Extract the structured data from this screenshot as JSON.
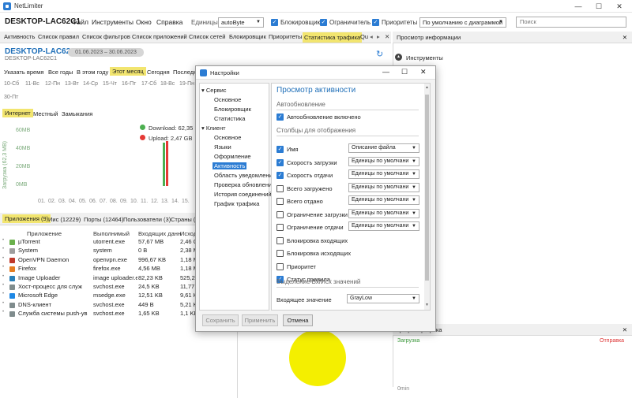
{
  "window": {
    "title": "NetLimiter"
  },
  "menubar": {
    "hostname": "DESKTOP-LAC62C1",
    "items": [
      "Файл",
      "Инструменты",
      "Окно",
      "Справка"
    ],
    "units_label": "Единицы",
    "units_value": "autoByte",
    "checkboxes": [
      "Блокировщик",
      "Ограничитель",
      "Приоритеты"
    ],
    "view_select": "По умолчанию с диаграммой",
    "search_placeholder": "Поиск"
  },
  "tabs": [
    "Активность",
    "Список правил",
    "Список фильтров",
    "Список приложений",
    "Список сетей",
    "Блокировщик",
    "Приоритеты",
    "Статистика трафика",
    "Qu"
  ],
  "stats": {
    "host": "DESKTOP-LAC62C1",
    "host_small": "DESKTOP-LAC62C1",
    "date_range": "01.06.2023 – 30.06.2023",
    "periods": [
      "Указать время",
      "Все годы",
      "В этом году",
      "Этот месяц",
      "Сегодня",
      "Последн"
    ],
    "days": [
      "10-Сб",
      "11-Вс",
      "12-Пн",
      "13-Вт",
      "14-Ср",
      "15-Чт",
      "16-Пт",
      "17-Сб",
      "18-Вс",
      "19-Пн",
      "30-Пт"
    ],
    "scope_tabs": [
      "Интернет",
      "Местный",
      "Замыкания"
    ]
  },
  "chart_data": {
    "type": "bar",
    "ylabel": "Загрузка (62,3 MB)",
    "yticks": [
      "60MB",
      "40MB",
      "20MB",
      "0MB"
    ],
    "ylim": [
      0,
      66
    ],
    "categories": [
      "01.",
      "02.",
      "03.",
      "04.",
      "05.",
      "06.",
      "07.",
      "08.",
      "09.",
      "10.",
      "11.",
      "12.",
      "13.",
      "14.",
      "15."
    ],
    "series": [
      {
        "name": "Download: 62,35 MB",
        "color": "#4caf50",
        "values": [
          0,
          0,
          0,
          0,
          0,
          0,
          0,
          0,
          0,
          0,
          0,
          0,
          42,
          0,
          0
        ]
      },
      {
        "name": "Upload: 2,47 GB",
        "color": "#e53935",
        "values": [
          0,
          0,
          0,
          0,
          0,
          0,
          0,
          0,
          0,
          0,
          0,
          0,
          44,
          0,
          0
        ]
      }
    ]
  },
  "bottom_tabs": [
    "Приложения (9)",
    "Ииc (12229)",
    "Порты (12464)",
    "Пользователи (3)",
    "Страны (1"
  ],
  "table": {
    "headers": [
      "Приложение",
      "Выполнимый",
      "Входящих данн",
      "Исходя"
    ],
    "rows": [
      {
        "name": "µTorrent",
        "exe": "utorrent.exe",
        "in": "57,67 MB",
        "out": "2,46 GI",
        "color": "#6ab04c"
      },
      {
        "name": "System",
        "exe": "system",
        "in": "0 B",
        "out": "2,38 M",
        "color": "#9e9e9e"
      },
      {
        "name": "OpenVPN Daemon",
        "exe": "openvpn.exe",
        "in": "996,67 KB",
        "out": "1,18 M",
        "color": "#c0392b"
      },
      {
        "name": "Firefox",
        "exe": "firefox.exe",
        "in": "4,56 MB",
        "out": "1,18 M",
        "color": "#e67e22"
      },
      {
        "name": "Image Uploader",
        "exe": "image uploader.exe",
        "in": "82,23 KB",
        "out": "525,22",
        "color": "#2980b9"
      },
      {
        "name": "Хост-процесс для служ",
        "exe": "svchost.exe",
        "in": "24,5 KB",
        "out": "11,77 K",
        "color": "#7f8c8d"
      },
      {
        "name": "Microsoft Edge",
        "exe": "msedge.exe",
        "in": "12,51 KB",
        "out": "9,61 KB",
        "color": "#1e88e5"
      },
      {
        "name": "DNS-клиент",
        "exe": "svchost.exe",
        "in": "449 B",
        "out": "5,21 KB",
        "color": "#7f8c8d"
      },
      {
        "name": "Служба системы push-ув",
        "exe": "svchost.exe",
        "in": "1,65 KB",
        "out": "1,1 KB",
        "color": "#7f8c8d"
      }
    ]
  },
  "info_panel": {
    "title": "Просмотр информации",
    "section": "Инструменты"
  },
  "traffic_panel": {
    "title": "График трафика",
    "download": "Загрузка",
    "upload": "Отправка",
    "axis": "0min"
  },
  "dialog": {
    "title": "Настройки",
    "nav": {
      "service": "Сервис",
      "service_items": [
        "Основное",
        "Блокировщик",
        "Статистика"
      ],
      "client": "Клиент",
      "client_items": [
        "Основное",
        "Языки",
        "Оформление",
        "Активность",
        "Область уведомлений",
        "Проверка обновлений",
        "История соединений",
        "График трафика"
      ]
    },
    "heading": "Просмотр активности",
    "autoupdate_section": "Автообновление",
    "autoupdate_label": "Автообновление включено",
    "columns_section": "Столбцы для отображения",
    "columns": [
      {
        "label": "Имя",
        "checked": true,
        "select": "Описание файла"
      },
      {
        "label": "Скорость загрузки",
        "checked": true,
        "select": "Единицы по умолчани"
      },
      {
        "label": "Скорость отдачи",
        "checked": true,
        "select": "Единицы по умолчани"
      },
      {
        "label": "Всего загружено",
        "checked": false,
        "select": "Единицы по умолчани"
      },
      {
        "label": "Всего отдано",
        "checked": false,
        "select": "Единицы по умолчани"
      },
      {
        "label": "Ограничение загрузки",
        "checked": false,
        "select": "Единицы по умолчани"
      },
      {
        "label": "Ограничение отдачи",
        "checked": false,
        "select": "Единицы по умолчани"
      },
      {
        "label": "Блокировка входящих",
        "checked": false
      },
      {
        "label": "Блокировка исходящих",
        "checked": false
      },
      {
        "label": "Приоритет",
        "checked": false
      },
      {
        "label": "Статус правила",
        "checked": true
      }
    ],
    "highlight_section": "Выделение Вх/Исх значений",
    "incoming_label": "Входящее значение",
    "incoming_value": "GrayLow",
    "buttons": {
      "save": "Сохранить",
      "apply": "Применить",
      "cancel": "Отмена"
    }
  }
}
